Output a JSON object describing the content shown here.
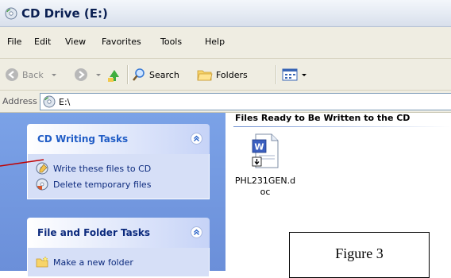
{
  "window": {
    "title": "CD Drive (E:)"
  },
  "menu": {
    "items": [
      "File",
      "Edit",
      "View",
      "Favorites",
      "Tools",
      "Help"
    ]
  },
  "toolbar": {
    "back_label": "Back",
    "search_label": "Search",
    "folders_label": "Folders"
  },
  "address": {
    "label": "Address",
    "value": "E:\\"
  },
  "sidebar": {
    "panels": [
      {
        "title": "CD Writing Tasks",
        "items": [
          "Write these files to CD",
          "Delete temporary files"
        ]
      },
      {
        "title": "File and Folder Tasks",
        "items": [
          "Make a new folder"
        ]
      }
    ]
  },
  "main": {
    "group_header": "Files Ready to Be Written to the CD",
    "files": [
      {
        "name_line1": "PHL231GEN.d",
        "name_line2": "oc",
        "icon": "word-document-icon"
      }
    ]
  },
  "figure": {
    "caption": "Figure 3"
  },
  "colors": {
    "sidebar_bg": "#6b8fd9",
    "panel_title": "#215dc6",
    "link": "#0c2a7d",
    "pointer": "#c00000"
  }
}
